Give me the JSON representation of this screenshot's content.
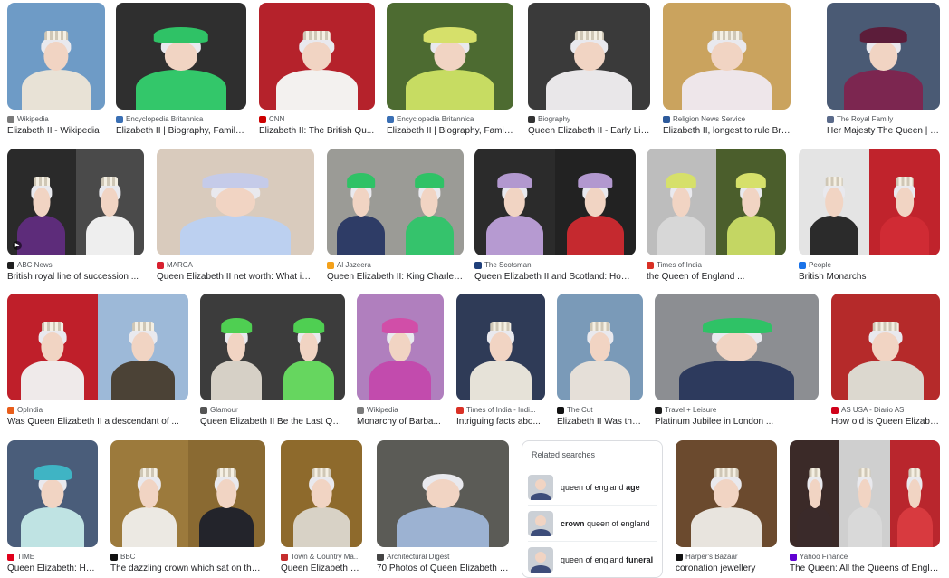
{
  "results": [
    {
      "source": "Wikipedia",
      "title": "Elizabeth II - Wikipedia",
      "fav": "#7a7a7a",
      "icon": "w-logo-icon",
      "bg": [
        "#6e9bc6"
      ],
      "outfit": [
        "#e8e2d6"
      ],
      "head": "crown"
    },
    {
      "source": "Encyclopedia Britannica",
      "title": "Elizabeth II | Biography, Family, ...",
      "fav": "#3a6fb4",
      "icon": "britannica-logo-icon",
      "bg": [
        "#2f2f2f"
      ],
      "outfit": [
        "#33c76a"
      ],
      "head": "hat",
      "hat": "#2fc266"
    },
    {
      "source": "CNN",
      "title": "Elizabeth II: The British Qu...",
      "fav": "#cc0000",
      "icon": "cnn-logo-icon",
      "bg": [
        "#b5222b"
      ],
      "outfit": [
        "#f3f1ef"
      ],
      "head": "crown"
    },
    {
      "source": "Encyclopedia Britannica",
      "title": "Elizabeth II | Biography, Family...",
      "fav": "#3a6fb4",
      "icon": "britannica-logo-icon",
      "bg": [
        "#4d6b31"
      ],
      "outfit": [
        "#c7dc62"
      ],
      "head": "hat",
      "hat": "#d6e06a"
    },
    {
      "source": "Biography",
      "title": "Queen Elizabeth II - Early Life...",
      "fav": "#333333",
      "icon": "biography-logo-icon",
      "bg": [
        "#3a3a3a"
      ],
      "outfit": [
        "#e9e7e9"
      ],
      "head": "crown"
    },
    {
      "source": "Religion News Service",
      "title": "Elizabeth II, longest to rule Britain ...",
      "fav": "#2d5a9b",
      "icon": "rns-logo-icon",
      "bg": [
        "#caa35e"
      ],
      "outfit": [
        "#eee6ea"
      ],
      "head": "crown"
    },
    {
      "source": "The Royal Family",
      "title": "Her Majesty The Queen | T...",
      "fav": "#5a6a8a",
      "icon": "royal-crest-icon",
      "bg": [
        "#4a5a74"
      ],
      "outfit": [
        "#7c2650"
      ],
      "head": "hat",
      "hat": "#5c1d3a"
    },
    {
      "source": "ABC News",
      "title": "British royal line of succession ...",
      "fav": "#1f1f1f",
      "icon": "abc-logo-icon",
      "bg": [
        "#2a2a2a",
        "#4a4a4a"
      ],
      "outfit": [
        "#5d2c7a",
        "#eeeeee"
      ],
      "head": "crown",
      "video": true
    },
    {
      "source": "MARCA",
      "title": "Queen Elizabeth II net worth: What is ...",
      "fav": "#d8202f",
      "icon": "marca-logo-icon",
      "bg": [
        "#d9cbbd"
      ],
      "outfit": [
        "#bcd0f0"
      ],
      "head": "hat",
      "hat": "#c5cbe9"
    },
    {
      "source": "Al Jazeera",
      "title": "Queen Elizabeth II: King Charles ...",
      "fav": "#f4a11a",
      "icon": "aljazeera-logo-icon",
      "bg": [
        "#9b9b96",
        "#9b9b96"
      ],
      "outfit": [
        "#2e3c66",
        "#35c36c"
      ],
      "head": "hat",
      "hat": "#2fc266"
    },
    {
      "source": "The Scotsman",
      "title": "Queen Elizabeth II and Scotland: How ...",
      "fav": "#1f3f7a",
      "icon": "scotsman-logo-icon",
      "bg": [
        "#2b2b2b",
        "#222222"
      ],
      "outfit": [
        "#b69ad1",
        "#c5292f"
      ],
      "head": "hat",
      "hat": "#b298cf"
    },
    {
      "source": "Times of India",
      "title": "the Queen of England ...",
      "fav": "#d93025",
      "icon": "toi-logo-icon",
      "bg": [
        "#bdbdbd",
        "#4b5e2c"
      ],
      "outfit": [
        "#d7d7d7",
        "#c4d663"
      ],
      "head": "hat",
      "hat": "#d6e06a"
    },
    {
      "source": "People",
      "title": "British Monarchs",
      "fav": "#1a73e8",
      "icon": "people-logo-icon",
      "bg": [
        "#e4e4e4",
        "#c0232c"
      ],
      "outfit": [
        "#2b2b2b",
        "#d02b34"
      ],
      "head": "crown"
    },
    {
      "source": "OpIndia",
      "title": "Was Queen Elizabeth II a descendant of ...",
      "fav": "#e85d1a",
      "icon": "opindia-logo-icon",
      "bg": [
        "#bf1f2a",
        "#9db9d8"
      ],
      "outfit": [
        "#efeaea",
        "#4b4236"
      ],
      "head": "crown"
    },
    {
      "source": "Glamour",
      "title": "Queen Elizabeth II Be the Last Que...",
      "fav": "#555555",
      "icon": "glamour-logo-icon",
      "bg": [
        "#3c3c3c",
        "#3c3c3c"
      ],
      "outfit": [
        "#d6d0c6",
        "#66d65f"
      ],
      "head": "hat",
      "hat": "#4fcf52"
    },
    {
      "source": "Wikipedia",
      "title": "Monarchy of Barba...",
      "fav": "#7a7a7a",
      "icon": "w-logo-icon",
      "bg": [
        "#b07fbe"
      ],
      "outfit": [
        "#c24bad"
      ],
      "head": "hat",
      "hat": "#d14ea8"
    },
    {
      "source": "Times of India - Indi...",
      "title": "Intriguing facts abo...",
      "fav": "#d93025",
      "icon": "toi-logo-icon",
      "bg": [
        "#2f3b57"
      ],
      "outfit": [
        "#e6e2d8"
      ],
      "head": "crown"
    },
    {
      "source": "The Cut",
      "title": "Elizabeth II Was the ...",
      "fav": "#111111",
      "icon": "thecut-logo-icon",
      "bg": [
        "#7a9ab8"
      ],
      "outfit": [
        "#e5dfd8"
      ],
      "head": "crown"
    },
    {
      "source": "Travel + Leisure",
      "title": "Platinum Jubilee in London ...",
      "fav": "#1d1d1d",
      "icon": "travelleisure-logo-icon",
      "bg": [
        "#8c8e92"
      ],
      "outfit": [
        "#2d3a5d"
      ],
      "head": "hat",
      "hat": "#2fc266"
    },
    {
      "source": "AS USA - Diario AS",
      "title": "How old is Queen Elizabe...",
      "fav": "#d0021b",
      "icon": "as-logo-icon",
      "bg": [
        "#b52a2a"
      ],
      "outfit": [
        "#dcd8cf"
      ],
      "head": "crown"
    },
    {
      "source": "TIME",
      "title": "Queen Elizabeth: Her...",
      "fav": "#e0001b",
      "icon": "time-logo-icon",
      "bg": [
        "#4a5d7a"
      ],
      "outfit": [
        "#bfe3e3"
      ],
      "head": "hat",
      "hat": "#3fb4c4"
    },
    {
      "source": "BBC",
      "title": "The dazzling crown which sat on the ...",
      "fav": "#111111",
      "icon": "bbc-logo-icon",
      "bg": [
        "#9c7a3c",
        "#8a6a32"
      ],
      "outfit": [
        "#ece9e3",
        "#23242b"
      ],
      "head": "crown"
    },
    {
      "source": "Town & Country Ma...",
      "title": "Queen Elizabeth Fa...",
      "fav": "#c52d2d",
      "icon": "towncountry-logo-icon",
      "bg": [
        "#8e6a2c"
      ],
      "outfit": [
        "#d8d2c6"
      ],
      "head": "crown"
    },
    {
      "source": "Architectural Digest",
      "title": "70 Photos of Queen Elizabeth II...",
      "fav": "#444444",
      "icon": "ad-logo-icon",
      "bg": [
        "#5b5b56"
      ],
      "outfit": [
        "#9cb2d2"
      ],
      "head": "plain"
    },
    {
      "source": "Harper's Bazaar",
      "title": "coronation jewellery",
      "fav": "#111111",
      "icon": "bazaar-logo-icon",
      "bg": [
        "#6b4a2e"
      ],
      "outfit": [
        "#e8e4de"
      ],
      "head": "crown"
    },
    {
      "source": "Yahoo Finance",
      "title": "The Queen: All the Queens of Engla...",
      "fav": "#6001d2",
      "icon": "yahoo-logo-icon",
      "bg": [
        "#3b2a28",
        "#cfcfcf",
        "#b9262d"
      ],
      "outfit": [
        "#3a2a2a",
        "#d9d9d9",
        "#d83a3f"
      ],
      "head": "crown"
    }
  ],
  "related": {
    "heading": "Related searches",
    "items": [
      {
        "pre": "queen of england ",
        "bold": "age",
        "post": ""
      },
      {
        "pre": "",
        "bold": "crown",
        "post": " queen of england"
      },
      {
        "pre": "queen of england ",
        "bold": "funeral",
        "post": ""
      }
    ]
  }
}
